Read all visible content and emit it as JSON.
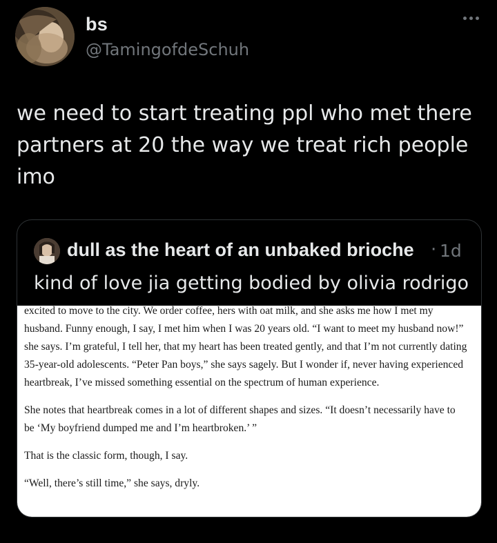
{
  "tweet": {
    "author_name": "bs",
    "author_handle": "@TamingofdeSchuh",
    "more_icon": "more-horizontal-icon",
    "text": "we need to start treating ppl who met there partners at 20 the way we treat rich people imo"
  },
  "quote": {
    "author_name": "dull as the heart of an unbaked brioche",
    "separator": "·",
    "time": "1d",
    "text": "kind of love jia getting bodied by olivia rodrigo",
    "image_text": {
      "paragraph1": "excited to move to the city. We order coffee, hers with oat milk, and she asks me how I met my husband. Funny enough, I say, I met him when I was 20 years old. “I want to meet my husband now!” she says. I’m grateful, I tell her, that my heart has been treated gently, and that I’m not currently dating 35-year-old adolescents. “Peter Pan boys,” she says sagely. But I wonder if, never having experienced heartbreak, I’ve missed something essential on the spectrum of human experience.",
      "paragraph2": "She notes that heartbreak comes in a lot of different shapes and sizes. “It doesn’t necessarily have to be ‘My boyfriend dumped me and I’m heartbroken.’ ”",
      "paragraph3": "That is the classic form, though, I say.",
      "paragraph4": "“Well, there’s still time,” she says, dryly."
    }
  }
}
